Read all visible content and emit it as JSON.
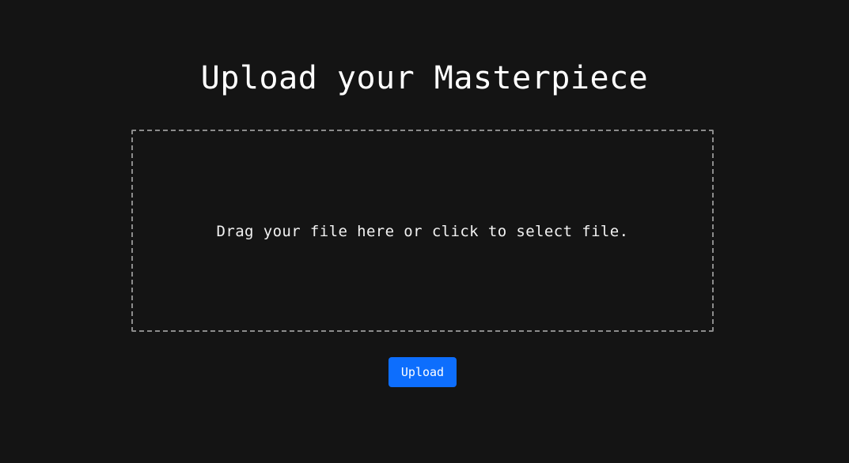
{
  "page": {
    "title": "Upload your Masterpiece"
  },
  "dropzone": {
    "prompt": "Drag your file here or click to select file."
  },
  "actions": {
    "upload_label": "Upload"
  },
  "colors": {
    "background": "#141414",
    "text": "#ffffff",
    "dropzone_border": "#8c8c8c",
    "button": "#0d6efd"
  }
}
